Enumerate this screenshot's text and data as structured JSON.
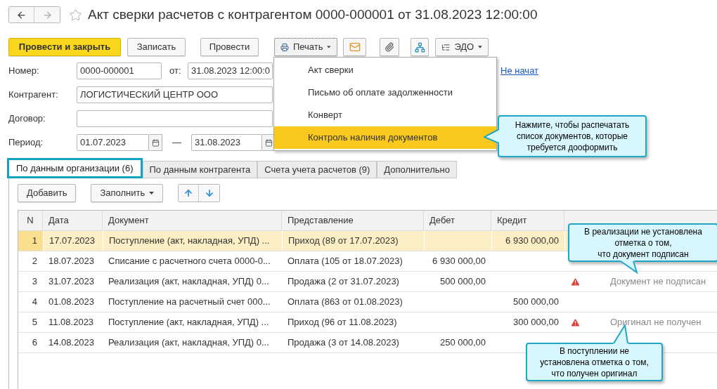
{
  "window": {
    "title": "Акт сверки расчетов с контрагентом 0000-000001 от 31.08.2023 12:00:00",
    "favorite": false
  },
  "command_bar": [
    {
      "label": "Провести и закрыть",
      "kind": "primary"
    },
    {
      "label": "Записать",
      "kind": "text"
    },
    {
      "label": "Провести",
      "kind": "text"
    },
    {
      "label": "Печать",
      "kind": "print",
      "focused": true
    },
    {
      "kind": "email"
    },
    {
      "kind": "attach"
    },
    {
      "kind": "structure"
    },
    {
      "label": "ЭДО",
      "kind": "edo"
    }
  ],
  "print_menu": [
    {
      "label": "Акт сверки",
      "selected": false
    },
    {
      "label": "Письмо об оплате задолженности",
      "selected": false
    },
    {
      "label": "Конверт",
      "selected": false
    },
    {
      "label": "Контроль наличия документов",
      "selected": true
    }
  ],
  "form": {
    "number": {
      "label": "Номер:",
      "value": "0000-000001"
    },
    "date": {
      "label": "от:",
      "value": "31.08.2023 12:00:0"
    },
    "status_link": "Не начат",
    "counterparty": {
      "label": "Контрагент:",
      "value": "ЛОГИСТИЧЕСКИЙ ЦЕНТР ООО"
    },
    "contract": {
      "label": "Договор:"
    },
    "period": {
      "label": "Период:",
      "from": "01.07.2023",
      "separator": "—",
      "to": "31.08.2023"
    }
  },
  "tabs": [
    {
      "label": "По данным организации (6)",
      "selected": true
    },
    {
      "label": "По данным контрагента",
      "selected": false
    },
    {
      "label": "Счета учета расчетов (9)",
      "selected": false
    },
    {
      "label": "Дополнительно",
      "selected": false
    }
  ],
  "table_toolbar": {
    "add": "Добавить",
    "fill": "Заполнить"
  },
  "table": {
    "columns": [
      "N",
      "Дата",
      "Документ",
      "Представление",
      "Дебет",
      "Кредит"
    ],
    "rows": [
      {
        "n": "1",
        "date": "17.07.2023",
        "document": "Поступление (акт, накладная, УПД) ...",
        "presentation": "Приход (89 от 17.07.2023)",
        "credit": "6 930 000,00",
        "selected": true
      },
      {
        "n": "2",
        "date": "18.07.2023",
        "document": "Списание с расчетного счета 0000-0...",
        "presentation": "Оплата (105 от 18.07.2023)",
        "debit": "6 930 000,00",
        "selected": false
      },
      {
        "n": "3",
        "date": "31.07.2023",
        "document": "Реализация (акт, накладная, УПД) 0...",
        "presentation": "Продажа (2 от 31.07.2023)",
        "debit": "500 000,00",
        "status": "Документ не подписан",
        "selected": false
      },
      {
        "n": "4",
        "date": "01.08.2023",
        "document": "Поступление на расчетный счет 000...",
        "presentation": "Оплата (863 от 01.08.2023)",
        "credit": "500 000,00",
        "selected": false
      },
      {
        "n": "5",
        "date": "11.08.2023",
        "document": "Поступление (акт, накладная, УПД) ...",
        "presentation": "Приход (96 от 11.08.2023)",
        "credit": "300 000,00",
        "status": "Оригинал не получен",
        "selected": false
      },
      {
        "n": "6",
        "date": "14.08.2023",
        "document": "Реализация (акт, накладная, УПД) 0...",
        "presentation": "Продажа (3 от 14.08.2023)",
        "debit": "250 000,00",
        "selected": false
      }
    ]
  },
  "callouts": [
    {
      "text": "Нажмите, чтобы распечатать\nсписок документов, которые\nтребуется дооформить"
    },
    {
      "text": "В реализации не установлена\nотметка о том,\nчто документ подписан"
    },
    {
      "text": "В поступлении не\nустановлена отметка о том,\nчто получен оригинал"
    }
  ]
}
